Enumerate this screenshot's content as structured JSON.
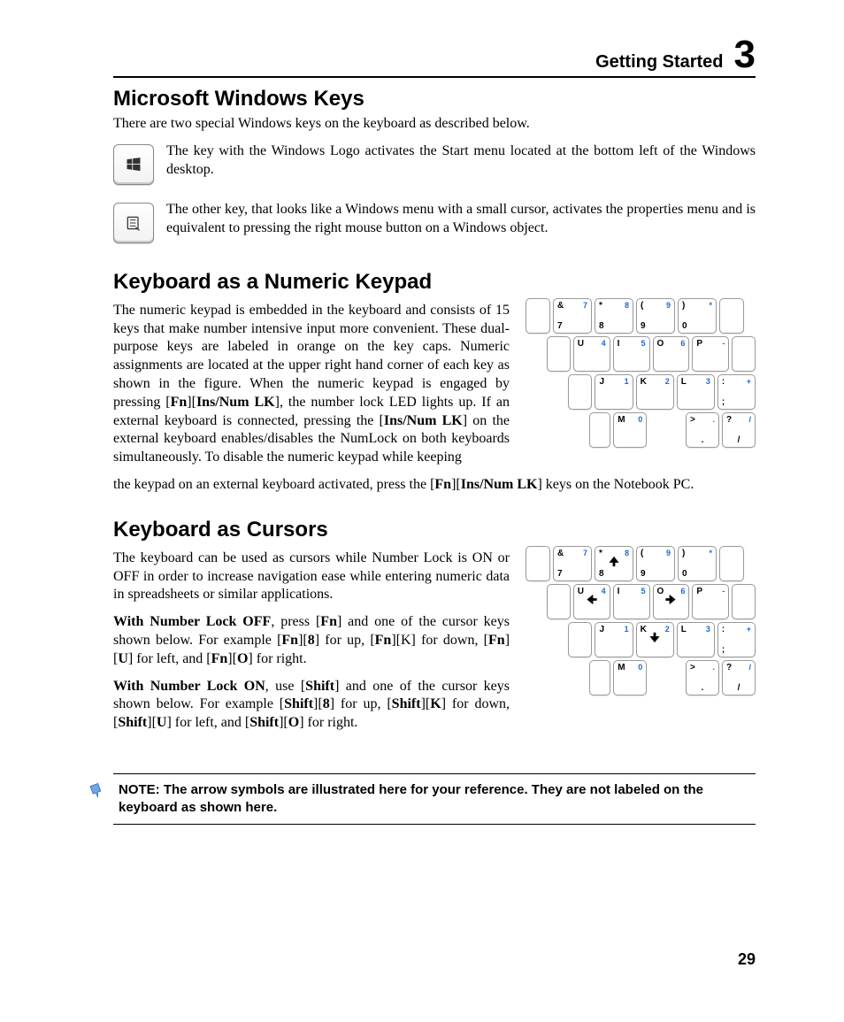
{
  "header": {
    "chapter_title": "Getting Started",
    "chapter_number": "3"
  },
  "s1": {
    "heading": "Microsoft Windows Keys",
    "intro": "There are two special Windows keys on the keyboard as described below.",
    "winkey_desc": "The key with the Windows Logo activates the Start menu located at the bottom left of the Windows desktop.",
    "menukey_desc": "The other key, that looks like a Windows menu with a small cursor, activates the properties menu and is equivalent to pressing the right mouse button on a Windows object."
  },
  "s2": {
    "heading": "Keyboard as a Numeric Keypad",
    "p_a": "The numeric keypad is embedded in the keyboard and consists of 15 keys that make number intensive input more convenient. These dual-purpose keys are labeled in orange on the key caps. Numeric assignments are located at the upper right hand corner of each key as shown in the figure. When the numeric keypad is engaged by pressing [",
    "kw1": "Fn",
    "brk1": "][",
    "kw2": "Ins/Num LK",
    "p_b": "], the number lock LED lights up. If an external keyboard is connected, pressing the [",
    "kw3": "Ins/Num LK",
    "p_c": "] on the external keyboard enables/disables the NumLock on both keyboards simultaneously. To disable the numeric keypad while keeping",
    "cont_a": "the keypad on an external keyboard activated, press the  [",
    "kw4": "Fn",
    "brk2": "][",
    "kw5": "Ins/Num LK",
    "cont_b": "] keys on the Notebook PC."
  },
  "s3": {
    "heading": "Keyboard as Cursors",
    "p1": "The keyboard can be used as cursors while Number Lock is ON or OFF in order to increase navigation ease while entering numeric data in spreadsheets or similar applications.",
    "off": {
      "lead": "With Number Lock OFF",
      "a": ", press [",
      "k1": "Fn",
      "b": "] and one of the cursor keys shown below. For example [",
      "k2": "Fn",
      "b2": "][",
      "k3": "8",
      "c": "] for up, [",
      "k4": "Fn",
      "c2": "][K] for down, [",
      "k5": "Fn",
      "c3": "][",
      "k6": "U",
      "d": "] for left, and [",
      "k7": "Fn",
      "d2": "][",
      "k8": "O",
      "e": "] for right."
    },
    "on": {
      "lead": "With Number Lock ON",
      "a": ", use [",
      "k1": "Shift",
      "b": "] and one of the cursor keys shown below. For example [",
      "k2": "Shift",
      "b2": "][",
      "k3": "8",
      "c": "] for up, [",
      "k4": "Shift",
      "c2": "][",
      "k5": "K",
      "d": "] for down, [",
      "k6": "Shift",
      "d2": "][",
      "k7": "U",
      "e": "] for left, and [",
      "k8": "Shift",
      "e2": "][",
      "k9": "O",
      "f": "] for right."
    }
  },
  "note": "NOTE: The arrow symbols are illustrated here for your reference. They are not labeled on the keyboard as shown here.",
  "page_number": "29",
  "keypad": {
    "r1": [
      {
        "tl": "&",
        "tr": "7",
        "bl": "7"
      },
      {
        "tl": "*",
        "tr": "8",
        "bl": "8"
      },
      {
        "tl": "(",
        "tr": "9",
        "bl": "9"
      },
      {
        "tl": ")",
        "tr": "*",
        "bl": "0"
      }
    ],
    "r2": [
      {
        "tl": "U",
        "tr": "4"
      },
      {
        "tl": "I",
        "tr": "5"
      },
      {
        "tl": "O",
        "tr": "6"
      },
      {
        "tl": "P",
        "tr": "-"
      }
    ],
    "r3": [
      {
        "tl": "J",
        "tr": "1"
      },
      {
        "tl": "K",
        "tr": "2"
      },
      {
        "tl": "L",
        "tr": "3"
      },
      {
        "tl": ":",
        "tr": "+",
        "bl": ";"
      }
    ],
    "r4": [
      {
        "tl": "M",
        "tr": "0"
      },
      {
        "tl": ">",
        "tr": ".",
        "bc": "."
      },
      {
        "tl": "?",
        "tr": "/",
        "bc": "/"
      }
    ]
  }
}
